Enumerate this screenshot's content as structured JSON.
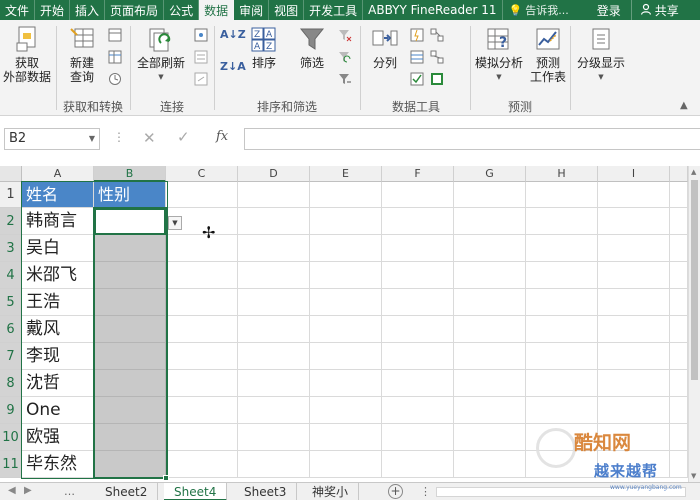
{
  "ribbon_tabs": [
    "文件",
    "开始",
    "插入",
    "页面布局",
    "公式",
    "数据",
    "审阅",
    "视图",
    "开发工具",
    "ABBYY FineReader 11"
  ],
  "active_tab": "数据",
  "tell_me": "告诉我...",
  "login": "登录",
  "share": "共享",
  "ribbon": {
    "get_external": "获取\n外部数据",
    "new_query": "新建\n查询",
    "group_get_transform": "获取和转换",
    "refresh_all": "全部刷新",
    "group_connections": "连接",
    "sort": "排序",
    "filter": "筛选",
    "group_sort_filter": "排序和筛选",
    "text_to_columns": "分列",
    "group_data_tools": "数据工具",
    "what_if": "模拟分析",
    "forecast_sheet": "预测\n工作表",
    "group_forecast": "预测",
    "outline": "分级显示"
  },
  "formula_bar": {
    "name_box": "B2",
    "fx": "fx",
    "formula": ""
  },
  "columns": [
    "A",
    "B",
    "C",
    "D",
    "E",
    "F",
    "G",
    "H",
    "I"
  ],
  "rows": [
    "1",
    "2",
    "3",
    "4",
    "5",
    "6",
    "7",
    "8",
    "9",
    "10",
    "11"
  ],
  "table": {
    "header_a": "姓名",
    "header_b": "性别",
    "names": [
      "韩商言",
      "吴白",
      "米邵飞",
      "王浩",
      "戴风",
      "李现",
      "沈哲",
      "One",
      "欧强",
      "毕东然"
    ]
  },
  "sheets": [
    "Sheet2",
    "Sheet4",
    "Sheet3",
    "神奖小"
  ],
  "active_sheet": "Sheet4",
  "watermark": {
    "brand": "酷知网",
    "sub": "越来越帮",
    "url": "www.yueyangbang.com"
  },
  "colors": {
    "excel_green": "#217346",
    "header_blue": "#4a86c8",
    "grey_fill": "#c9c9c9"
  }
}
